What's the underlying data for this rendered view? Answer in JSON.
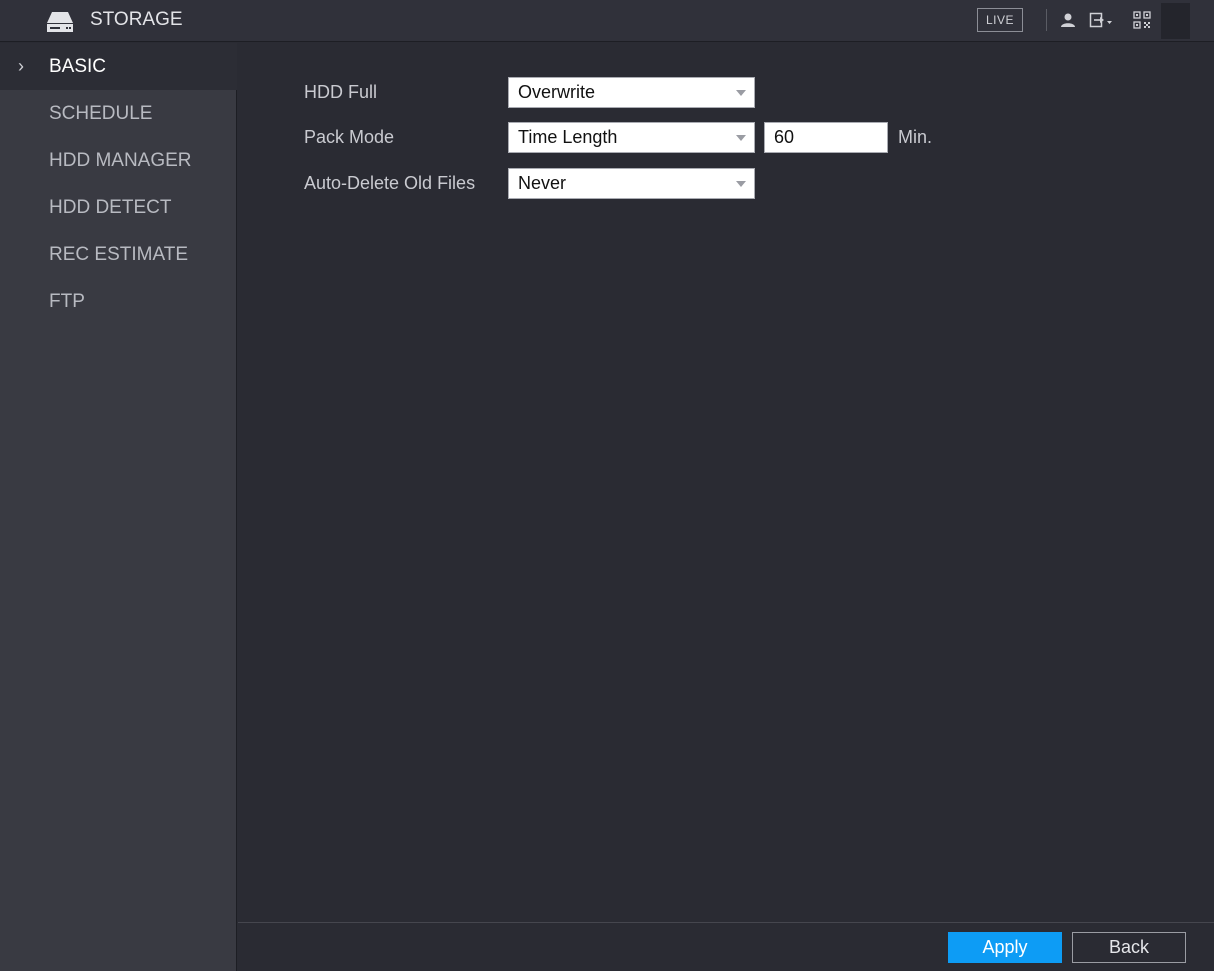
{
  "header": {
    "title": "STORAGE",
    "logo_icon": "hdd-icon",
    "live_label": "LIVE",
    "icons": [
      "user-icon",
      "logout-icon",
      "qr-code-icon"
    ]
  },
  "sidebar": {
    "items": [
      {
        "label": "BASIC",
        "active": true
      },
      {
        "label": "SCHEDULE",
        "active": false
      },
      {
        "label": "HDD MANAGER",
        "active": false
      },
      {
        "label": "HDD DETECT",
        "active": false
      },
      {
        "label": "REC ESTIMATE",
        "active": false
      },
      {
        "label": "FTP",
        "active": false
      }
    ]
  },
  "form": {
    "hdd_full": {
      "label": "HDD Full",
      "value": "Overwrite"
    },
    "pack_mode": {
      "label": "Pack Mode",
      "value": "Time Length",
      "duration": "60",
      "unit": "Min."
    },
    "auto_delete": {
      "label": "Auto-Delete Old Files",
      "value": "Never"
    }
  },
  "footer": {
    "apply_label": "Apply",
    "back_label": "Back"
  },
  "colors": {
    "accent": "#0d9cf5",
    "background": "#2a2b33",
    "sidebar": "#393a42"
  }
}
